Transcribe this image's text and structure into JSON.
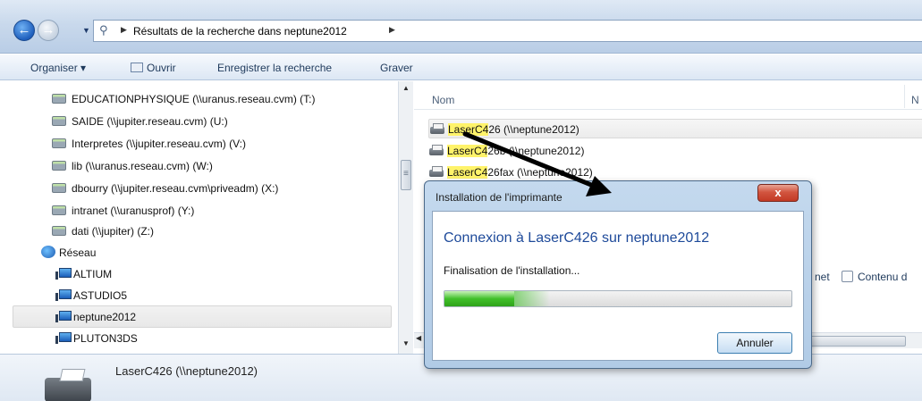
{
  "address_bar": {
    "path": "Résultats de la recherche dans neptune2012"
  },
  "toolbar": {
    "organize": "Organiser ▾",
    "open": "Ouvrir",
    "save_search": "Enregistrer la recherche",
    "burn": "Graver"
  },
  "nav_pane": {
    "drives": [
      "EDUCATIONPHYSIQUE (\\\\uranus.reseau.cvm) (T:)",
      "SAIDE (\\\\jupiter.reseau.cvm) (U:)",
      "Interpretes (\\\\jupiter.reseau.cvm) (V:)",
      "lib (\\\\uranus.reseau.cvm) (W:)",
      "dbourry (\\\\jupiter.reseau.cvm\\priveadm) (X:)",
      "intranet (\\\\uranusprof) (Y:)",
      "dati (\\\\jupiter) (Z:)"
    ],
    "network": "Réseau",
    "computers": [
      "ALTIUM",
      "ASTUDIO5",
      "neptune2012",
      "PLUTON3DS"
    ]
  },
  "content": {
    "column_name": "Nom",
    "column_next": "N",
    "results": [
      {
        "match": "LaserC4",
        "rest": "26 (\\\\neptune2012)"
      },
      {
        "match": "LaserC4",
        "rest": "26b (\\\\neptune2012)"
      },
      {
        "match": "LaserC4",
        "rest": "26fax (\\\\neptune2012)"
      }
    ],
    "commands": {
      "partial": "net",
      "content": "Contenu d"
    }
  },
  "details": {
    "title": "LaserC426 (\\\\neptune2012)"
  },
  "dialog": {
    "title": "Installation de l'imprimante",
    "close": "x",
    "heading": "Connexion à LaserC426 sur neptune2012",
    "status": "Finalisation de l'installation...",
    "progress_fraction": 0.2,
    "cancel": "Annuler"
  },
  "colors": {
    "highlight": "#fff36a",
    "heading_blue": "#1e4a9a",
    "progress_green": "#40c02a",
    "close_red": "#c23a25",
    "annotation_arrow": "#000000"
  }
}
